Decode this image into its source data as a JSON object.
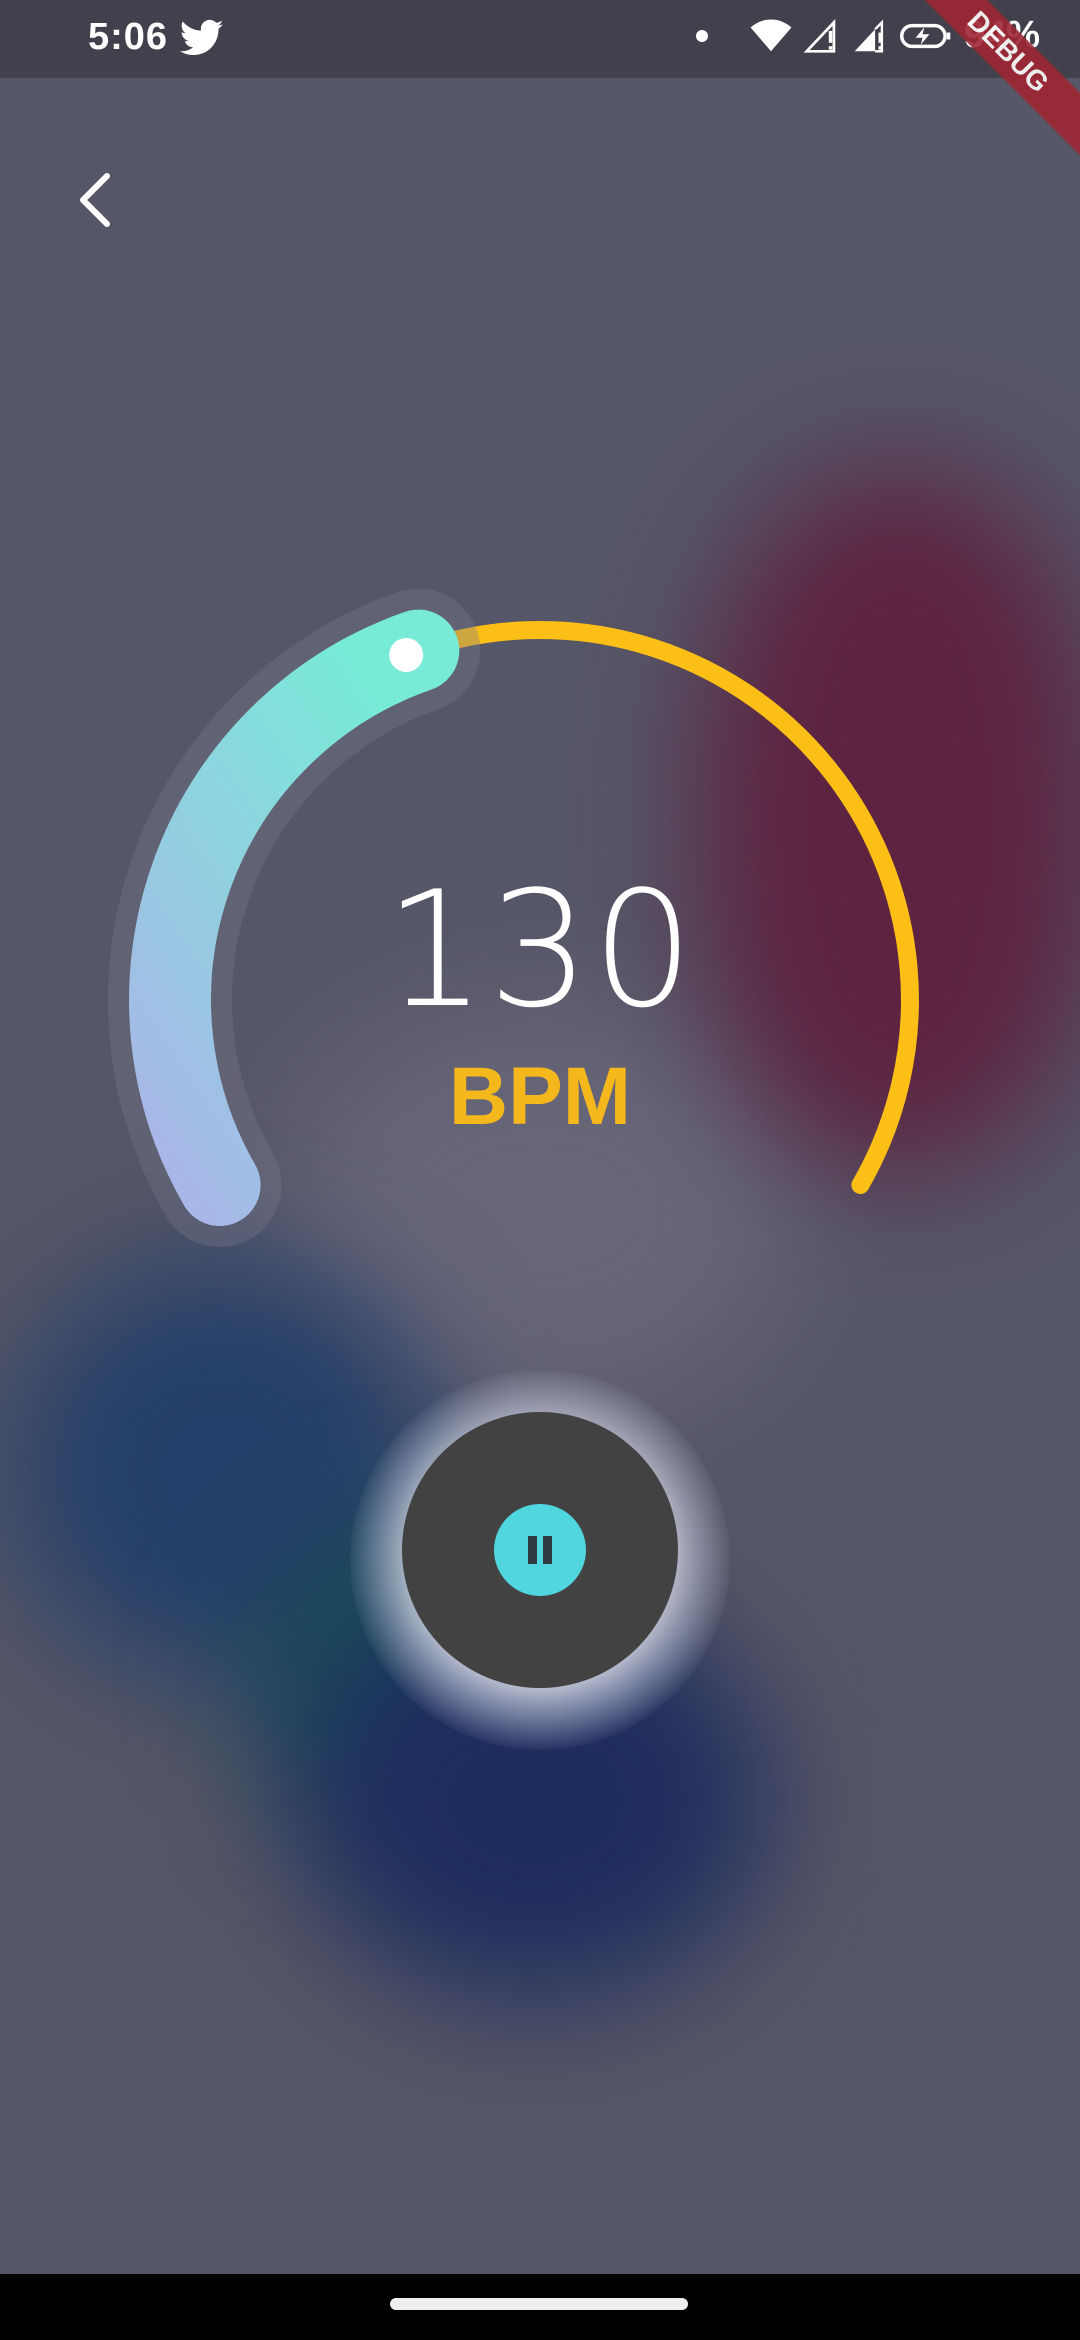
{
  "status_bar": {
    "time": "5:06",
    "battery": "94%",
    "notification_icon": "twitter-icon"
  },
  "debug_banner": "DEBUG",
  "header": {
    "back_icon": "chevron-left-icon"
  },
  "tempo": {
    "value": "130",
    "unit": "BPM",
    "level_fraction": 0.42
  },
  "controls": {
    "play_state_icon": "pause-icon"
  },
  "colors": {
    "background": "#555667",
    "accent_yellow": "#f4b81c",
    "gradient_start": "#a9b6e8",
    "gradient_end": "#78ead8",
    "pause_accent": "#4fd6df",
    "button_dark": "#424242"
  }
}
